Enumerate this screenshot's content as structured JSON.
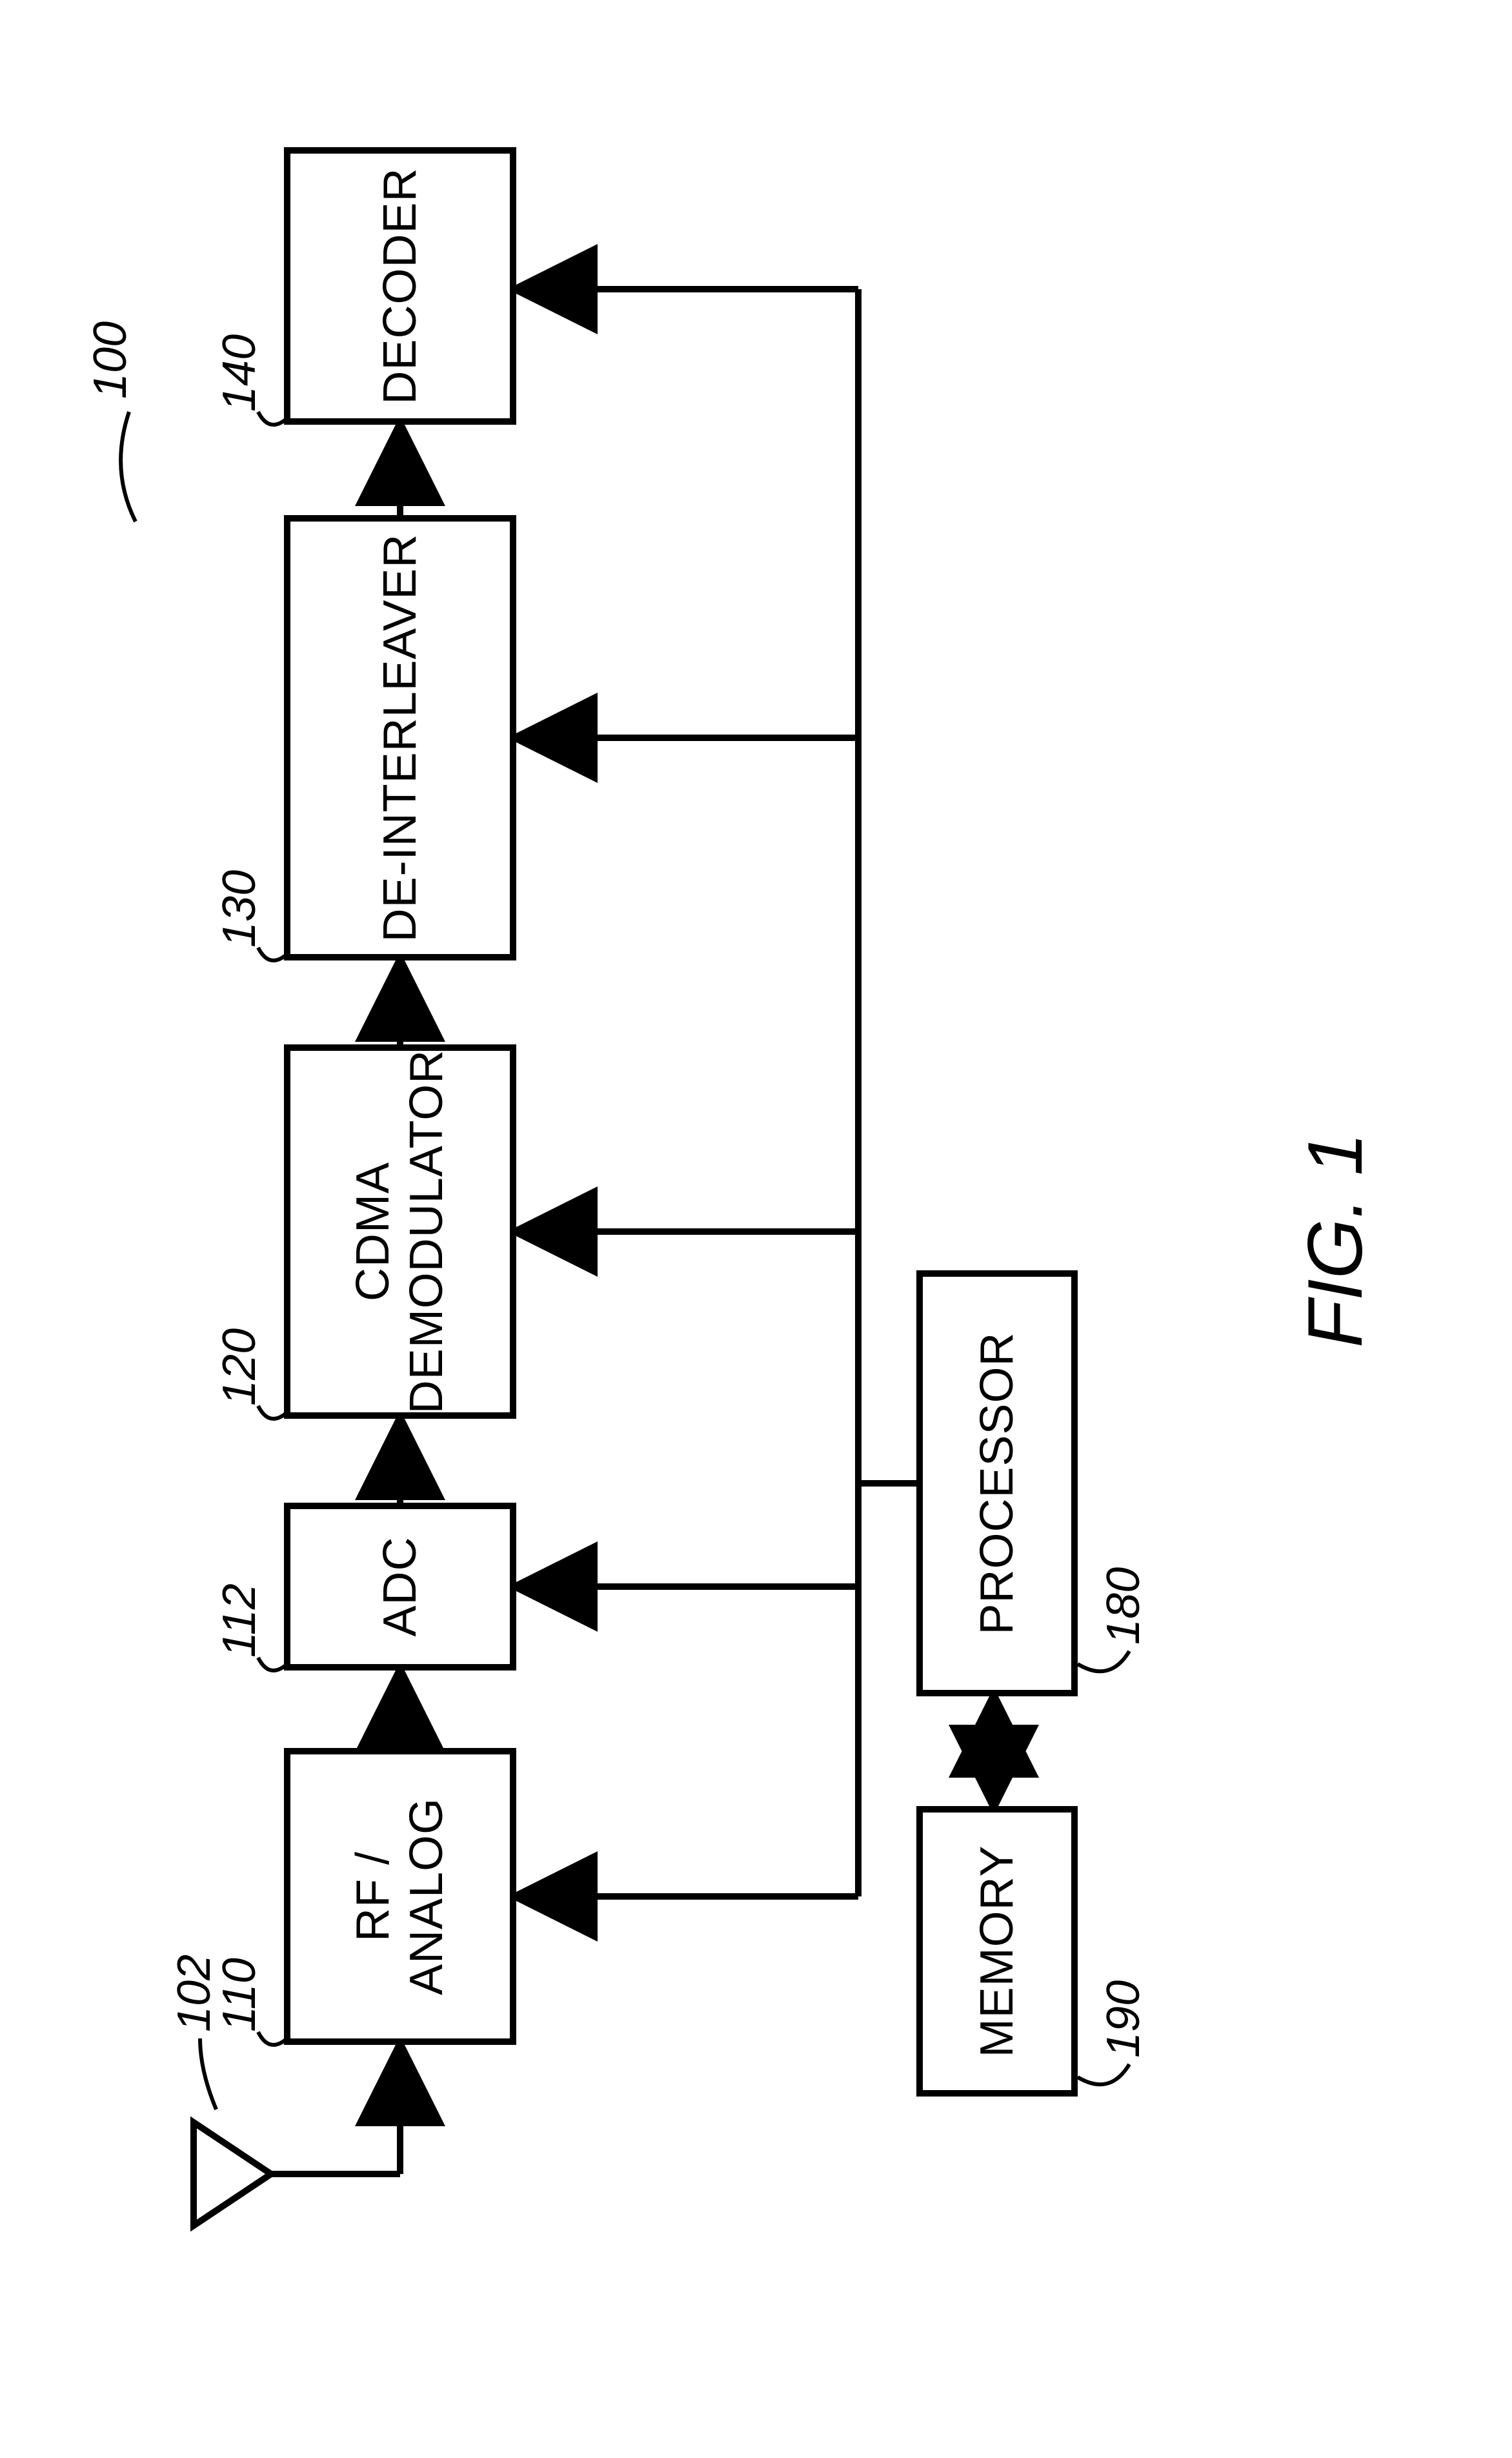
{
  "figure_label": "FIG. 1",
  "system_ref": "100",
  "blocks": {
    "antenna": {
      "ref": "102"
    },
    "rf_analog": {
      "ref": "110",
      "label": "RF / ANALOG"
    },
    "adc": {
      "ref": "112",
      "label": "ADC"
    },
    "cdma_demod": {
      "ref": "120",
      "label": "CDMA\nDEMODULATOR"
    },
    "deinterleaver": {
      "ref": "130",
      "label": "DE-INTERLEAVER"
    },
    "decoder": {
      "ref": "140",
      "label": "DECODER"
    },
    "processor": {
      "ref": "180",
      "label": "PROCESSOR"
    },
    "memory": {
      "ref": "190",
      "label": "MEMORY"
    }
  }
}
